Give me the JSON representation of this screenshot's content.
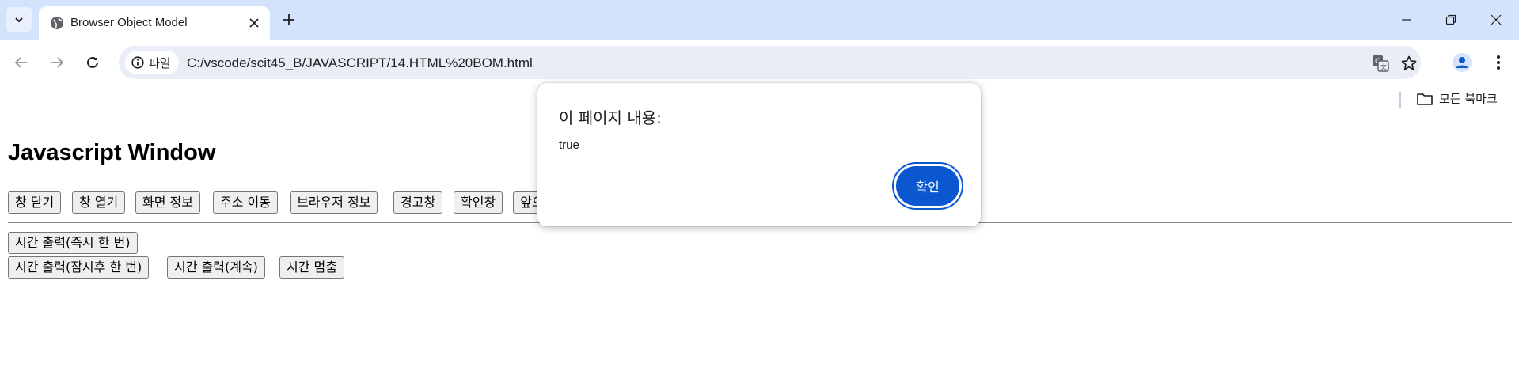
{
  "browser": {
    "tab_title": "Browser Object Model",
    "site_chip": "파일",
    "url": "C:/vscode/scit45_B/JAVASCRIPT/14.HTML%20BOM.html",
    "bookmarks_all": "모든 북마크",
    "accent": "#0b57d0",
    "tabstrip_color": "#d3e3fd"
  },
  "page": {
    "title": "Javascript Window",
    "row1": [
      "창 닫기",
      "창 열기",
      "화면 정보",
      "주소 이동",
      "브라우저 정보",
      "경고창",
      "확인창",
      "앞으"
    ],
    "row2": [
      "시간 출력(즉시 한 번)"
    ],
    "row3": [
      "시간 출력(잠시후 한 번)",
      "시간 출력(계속)",
      "시간 멈춤"
    ]
  },
  "dialog": {
    "title": "이 페이지 내용:",
    "message": "true",
    "ok_label": "확인"
  }
}
